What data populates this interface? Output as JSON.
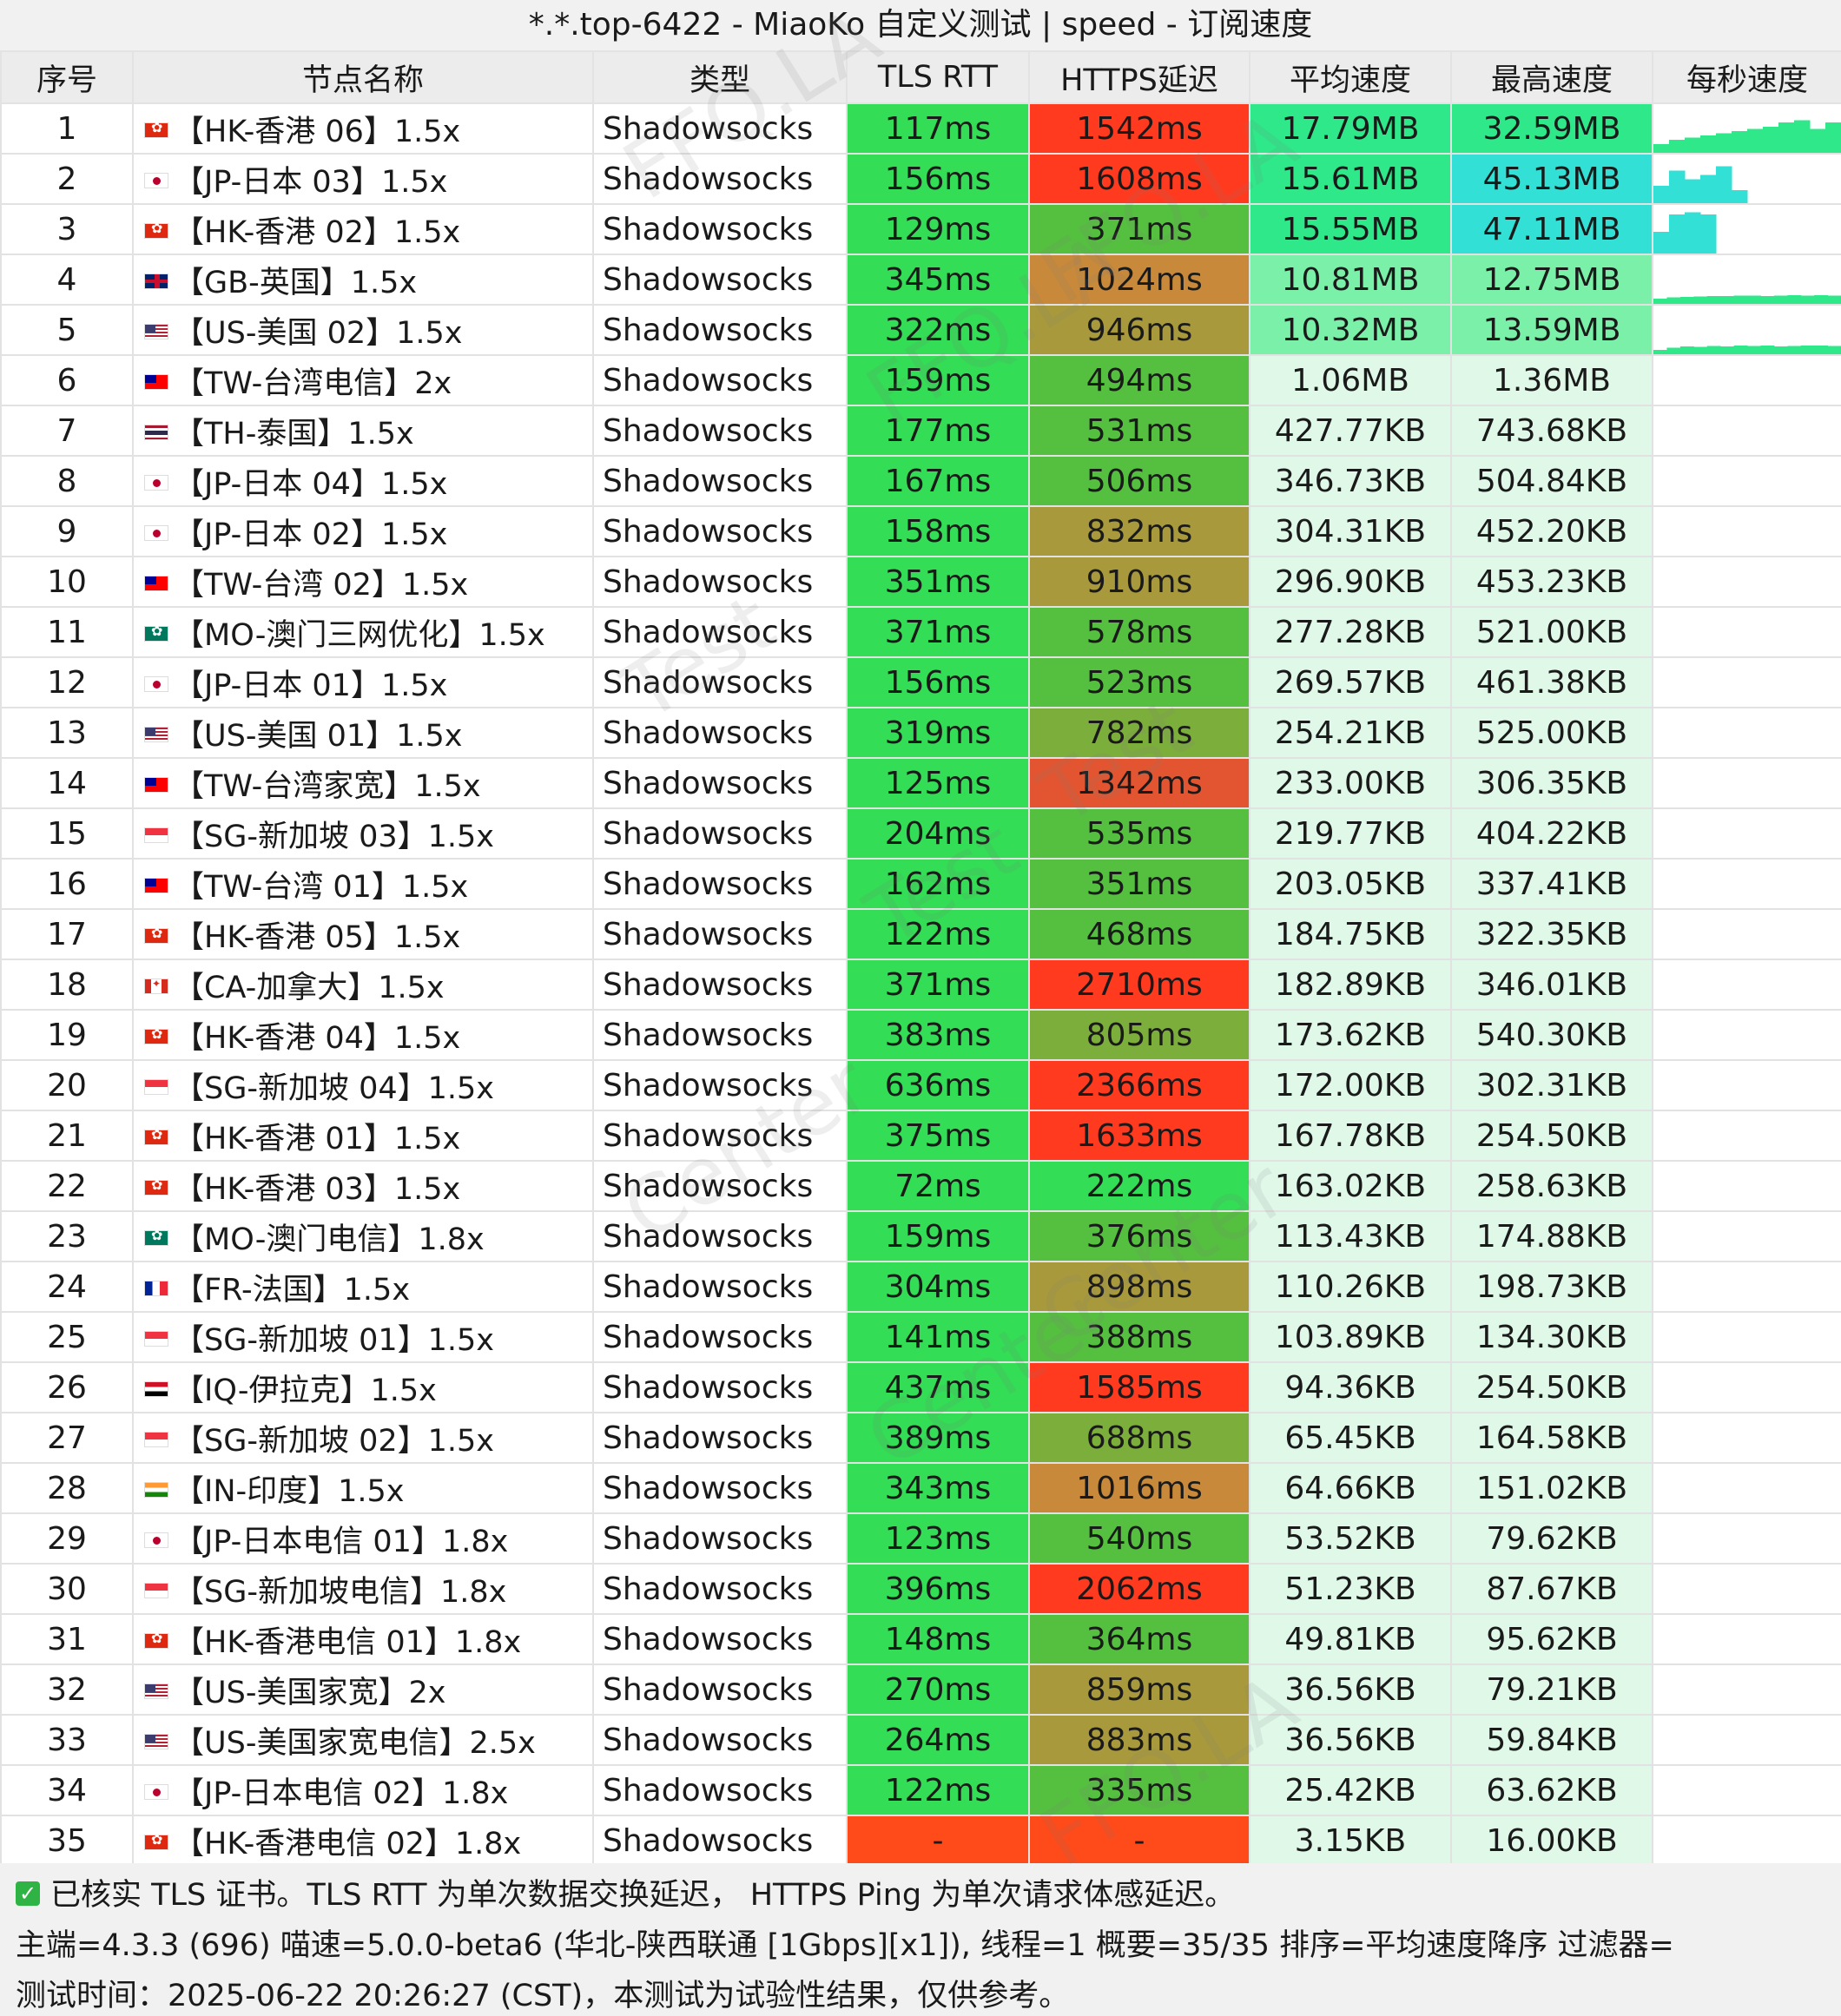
{
  "title": "*.*.top-6422 - MiaoKo 自定义测试 | speed - 订阅速度",
  "columns": {
    "index": "序号",
    "name": "节点名称",
    "type": "类型",
    "tls_rtt": "TLS RTT",
    "https_delay": "HTTPS延迟",
    "avg_speed": "平均速度",
    "max_speed": "最高速度",
    "per_second": "每秒速度"
  },
  "colors": {
    "tls_green": "#33dd55",
    "https_scale": [
      "#33dd55",
      "#55c040",
      "#7cae3c",
      "#a8993c",
      "#c8893a",
      "#e35530",
      "#ff3a1f"
    ],
    "speed_top": "#2ee88a",
    "speed_mid": "#7af0a8",
    "speed_low": "#dff8e8",
    "cyan": "#33e0d5",
    "fail": "#ff4a1a"
  },
  "rows": [
    {
      "idx": "1",
      "flag": "hk",
      "name": "【HK-香港 06】1.5x",
      "type": "Shadowsocks",
      "tls": "117ms",
      "https": "1542ms",
      "https_level": 6,
      "avg": "17.79MB",
      "avg_level": "top",
      "max": "32.59MB",
      "max_level": "top",
      "spark": [
        0.2,
        0.3,
        0.35,
        0.4,
        0.45,
        0.5,
        0.55,
        0.6,
        0.7,
        0.75,
        0.55,
        0.7
      ],
      "spark_color": "#2ee88a"
    },
    {
      "idx": "2",
      "flag": "jp",
      "name": "【JP-日本 03】1.5x",
      "type": "Shadowsocks",
      "tls": "156ms",
      "https": "1608ms",
      "https_level": 6,
      "avg": "15.61MB",
      "avg_level": "top",
      "max": "45.13MB",
      "max_level": "cyan",
      "spark": [
        0.4,
        0.75,
        0.55,
        0.65,
        0.85,
        0.3
      ],
      "spark_color": "#33e0d5"
    },
    {
      "idx": "3",
      "flag": "hk",
      "name": "【HK-香港 02】1.5x",
      "type": "Shadowsocks",
      "tls": "129ms",
      "https": "371ms",
      "https_level": 1,
      "avg": "15.55MB",
      "avg_level": "top",
      "max": "47.11MB",
      "max_level": "cyan",
      "spark": [
        0.5,
        0.9,
        0.95,
        0.9
      ],
      "spark_color": "#33e0d5"
    },
    {
      "idx": "4",
      "flag": "gb",
      "name": "【GB-英国】1.5x",
      "type": "Shadowsocks",
      "tls": "345ms",
      "https": "1024ms",
      "https_level": 4,
      "avg": "10.81MB",
      "avg_level": "mid",
      "max": "12.75MB",
      "max_level": "mid",
      "spark": [
        0.12,
        0.15,
        0.16,
        0.17,
        0.18,
        0.18,
        0.19,
        0.19,
        0.18,
        0.19,
        0.2,
        0.19,
        0.2,
        0.19
      ],
      "spark_color": "#2ee88a"
    },
    {
      "idx": "5",
      "flag": "us",
      "name": "【US-美国 02】1.5x",
      "type": "Shadowsocks",
      "tls": "322ms",
      "https": "946ms",
      "https_level": 3,
      "avg": "10.32MB",
      "avg_level": "mid",
      "max": "13.59MB",
      "max_level": "mid",
      "spark": [
        0.1,
        0.15,
        0.18,
        0.17,
        0.19,
        0.18,
        0.2,
        0.19,
        0.2,
        0.18,
        0.19,
        0.2,
        0.2,
        0.19
      ],
      "spark_color": "#2ee88a"
    },
    {
      "idx": "6",
      "flag": "tw",
      "name": "【TW-台湾电信】2x",
      "type": "Shadowsocks",
      "tls": "159ms",
      "https": "494ms",
      "https_level": 1,
      "avg": "1.06MB",
      "avg_level": "low",
      "max": "1.36MB",
      "max_level": "low",
      "spark": [],
      "spark_color": "#2ee88a"
    },
    {
      "idx": "7",
      "flag": "th",
      "name": "【TH-泰国】1.5x",
      "type": "Shadowsocks",
      "tls": "177ms",
      "https": "531ms",
      "https_level": 1,
      "avg": "427.77KB",
      "avg_level": "low",
      "max": "743.68KB",
      "max_level": "low",
      "spark": [],
      "spark_color": "#2ee88a"
    },
    {
      "idx": "8",
      "flag": "jp",
      "name": "【JP-日本 04】1.5x",
      "type": "Shadowsocks",
      "tls": "167ms",
      "https": "506ms",
      "https_level": 1,
      "avg": "346.73KB",
      "avg_level": "low",
      "max": "504.84KB",
      "max_level": "low",
      "spark": [],
      "spark_color": "#2ee88a"
    },
    {
      "idx": "9",
      "flag": "jp",
      "name": "【JP-日本 02】1.5x",
      "type": "Shadowsocks",
      "tls": "158ms",
      "https": "832ms",
      "https_level": 3,
      "avg": "304.31KB",
      "avg_level": "low",
      "max": "452.20KB",
      "max_level": "low",
      "spark": [],
      "spark_color": "#2ee88a"
    },
    {
      "idx": "10",
      "flag": "tw",
      "name": "【TW-台湾 02】1.5x",
      "type": "Shadowsocks",
      "tls": "351ms",
      "https": "910ms",
      "https_level": 3,
      "avg": "296.90KB",
      "avg_level": "low",
      "max": "453.23KB",
      "max_level": "low",
      "spark": [],
      "spark_color": "#2ee88a"
    },
    {
      "idx": "11",
      "flag": "mo",
      "name": "【MO-澳门三网优化】1.5x",
      "type": "Shadowsocks",
      "tls": "371ms",
      "https": "578ms",
      "https_level": 1,
      "avg": "277.28KB",
      "avg_level": "low",
      "max": "521.00KB",
      "max_level": "low",
      "spark": [],
      "spark_color": "#2ee88a"
    },
    {
      "idx": "12",
      "flag": "jp",
      "name": "【JP-日本 01】1.5x",
      "type": "Shadowsocks",
      "tls": "156ms",
      "https": "523ms",
      "https_level": 1,
      "avg": "269.57KB",
      "avg_level": "low",
      "max": "461.38KB",
      "max_level": "low",
      "spark": [],
      "spark_color": "#2ee88a"
    },
    {
      "idx": "13",
      "flag": "us",
      "name": "【US-美国 01】1.5x",
      "type": "Shadowsocks",
      "tls": "319ms",
      "https": "782ms",
      "https_level": 2,
      "avg": "254.21KB",
      "avg_level": "low",
      "max": "525.00KB",
      "max_level": "low",
      "spark": [],
      "spark_color": "#2ee88a"
    },
    {
      "idx": "14",
      "flag": "tw",
      "name": "【TW-台湾家宽】1.5x",
      "type": "Shadowsocks",
      "tls": "125ms",
      "https": "1342ms",
      "https_level": 5,
      "avg": "233.00KB",
      "avg_level": "low",
      "max": "306.35KB",
      "max_level": "low",
      "spark": [],
      "spark_color": "#2ee88a"
    },
    {
      "idx": "15",
      "flag": "sg",
      "name": "【SG-新加坡 03】1.5x",
      "type": "Shadowsocks",
      "tls": "204ms",
      "https": "535ms",
      "https_level": 1,
      "avg": "219.77KB",
      "avg_level": "low",
      "max": "404.22KB",
      "max_level": "low",
      "spark": [],
      "spark_color": "#2ee88a"
    },
    {
      "idx": "16",
      "flag": "tw",
      "name": "【TW-台湾 01】1.5x",
      "type": "Shadowsocks",
      "tls": "162ms",
      "https": "351ms",
      "https_level": 1,
      "avg": "203.05KB",
      "avg_level": "low",
      "max": "337.41KB",
      "max_level": "low",
      "spark": [],
      "spark_color": "#2ee88a"
    },
    {
      "idx": "17",
      "flag": "hk",
      "name": "【HK-香港 05】1.5x",
      "type": "Shadowsocks",
      "tls": "122ms",
      "https": "468ms",
      "https_level": 1,
      "avg": "184.75KB",
      "avg_level": "low",
      "max": "322.35KB",
      "max_level": "low",
      "spark": [],
      "spark_color": "#2ee88a"
    },
    {
      "idx": "18",
      "flag": "ca",
      "name": "【CA-加拿大】1.5x",
      "type": "Shadowsocks",
      "tls": "371ms",
      "https": "2710ms",
      "https_level": 6,
      "avg": "182.89KB",
      "avg_level": "low",
      "max": "346.01KB",
      "max_level": "low",
      "spark": [],
      "spark_color": "#2ee88a"
    },
    {
      "idx": "19",
      "flag": "hk",
      "name": "【HK-香港 04】1.5x",
      "type": "Shadowsocks",
      "tls": "383ms",
      "https": "805ms",
      "https_level": 2,
      "avg": "173.62KB",
      "avg_level": "low",
      "max": "540.30KB",
      "max_level": "low",
      "spark": [],
      "spark_color": "#2ee88a"
    },
    {
      "idx": "20",
      "flag": "sg",
      "name": "【SG-新加坡 04】1.5x",
      "type": "Shadowsocks",
      "tls": "636ms",
      "https": "2366ms",
      "https_level": 6,
      "avg": "172.00KB",
      "avg_level": "low",
      "max": "302.31KB",
      "max_level": "low",
      "spark": [],
      "spark_color": "#2ee88a"
    },
    {
      "idx": "21",
      "flag": "hk",
      "name": "【HK-香港 01】1.5x",
      "type": "Shadowsocks",
      "tls": "375ms",
      "https": "1633ms",
      "https_level": 6,
      "avg": "167.78KB",
      "avg_level": "low",
      "max": "254.50KB",
      "max_level": "low",
      "spark": [],
      "spark_color": "#2ee88a"
    },
    {
      "idx": "22",
      "flag": "hk",
      "name": "【HK-香港 03】1.5x",
      "type": "Shadowsocks",
      "tls": "72ms",
      "https": "222ms",
      "https_level": 0,
      "avg": "163.02KB",
      "avg_level": "low",
      "max": "258.63KB",
      "max_level": "low",
      "spark": [],
      "spark_color": "#2ee88a"
    },
    {
      "idx": "23",
      "flag": "mo",
      "name": "【MO-澳门电信】1.8x",
      "type": "Shadowsocks",
      "tls": "159ms",
      "https": "376ms",
      "https_level": 1,
      "avg": "113.43KB",
      "avg_level": "low",
      "max": "174.88KB",
      "max_level": "low",
      "spark": [],
      "spark_color": "#2ee88a"
    },
    {
      "idx": "24",
      "flag": "fr",
      "name": "【FR-法国】1.5x",
      "type": "Shadowsocks",
      "tls": "304ms",
      "https": "898ms",
      "https_level": 3,
      "avg": "110.26KB",
      "avg_level": "low",
      "max": "198.73KB",
      "max_level": "low",
      "spark": [],
      "spark_color": "#2ee88a"
    },
    {
      "idx": "25",
      "flag": "sg",
      "name": "【SG-新加坡 01】1.5x",
      "type": "Shadowsocks",
      "tls": "141ms",
      "https": "388ms",
      "https_level": 1,
      "avg": "103.89KB",
      "avg_level": "low",
      "max": "134.30KB",
      "max_level": "low",
      "spark": [],
      "spark_color": "#2ee88a"
    },
    {
      "idx": "26",
      "flag": "iq",
      "name": "【IQ-伊拉克】1.5x",
      "type": "Shadowsocks",
      "tls": "437ms",
      "https": "1585ms",
      "https_level": 6,
      "avg": "94.36KB",
      "avg_level": "low",
      "max": "254.50KB",
      "max_level": "low",
      "spark": [],
      "spark_color": "#2ee88a"
    },
    {
      "idx": "27",
      "flag": "sg",
      "name": "【SG-新加坡 02】1.5x",
      "type": "Shadowsocks",
      "tls": "389ms",
      "https": "688ms",
      "https_level": 2,
      "avg": "65.45KB",
      "avg_level": "low",
      "max": "164.58KB",
      "max_level": "low",
      "spark": [],
      "spark_color": "#2ee88a"
    },
    {
      "idx": "28",
      "flag": "in",
      "name": "【IN-印度】1.5x",
      "type": "Shadowsocks",
      "tls": "343ms",
      "https": "1016ms",
      "https_level": 4,
      "avg": "64.66KB",
      "avg_level": "low",
      "max": "151.02KB",
      "max_level": "low",
      "spark": [],
      "spark_color": "#2ee88a"
    },
    {
      "idx": "29",
      "flag": "jp",
      "name": "【JP-日本电信 01】1.8x",
      "type": "Shadowsocks",
      "tls": "123ms",
      "https": "540ms",
      "https_level": 1,
      "avg": "53.52KB",
      "avg_level": "low",
      "max": "79.62KB",
      "max_level": "low",
      "spark": [],
      "spark_color": "#2ee88a"
    },
    {
      "idx": "30",
      "flag": "sg",
      "name": "【SG-新加坡电信】1.8x",
      "type": "Shadowsocks",
      "tls": "396ms",
      "https": "2062ms",
      "https_level": 6,
      "avg": "51.23KB",
      "avg_level": "low",
      "max": "87.67KB",
      "max_level": "low",
      "spark": [],
      "spark_color": "#2ee88a"
    },
    {
      "idx": "31",
      "flag": "hk",
      "name": "【HK-香港电信 01】1.8x",
      "type": "Shadowsocks",
      "tls": "148ms",
      "https": "364ms",
      "https_level": 1,
      "avg": "49.81KB",
      "avg_level": "low",
      "max": "95.62KB",
      "max_level": "low",
      "spark": [],
      "spark_color": "#2ee88a"
    },
    {
      "idx": "32",
      "flag": "us",
      "name": "【US-美国家宽】2x",
      "type": "Shadowsocks",
      "tls": "270ms",
      "https": "859ms",
      "https_level": 3,
      "avg": "36.56KB",
      "avg_level": "low",
      "max": "79.21KB",
      "max_level": "low",
      "spark": [],
      "spark_color": "#2ee88a"
    },
    {
      "idx": "33",
      "flag": "us",
      "name": "【US-美国家宽电信】2.5x",
      "type": "Shadowsocks",
      "tls": "264ms",
      "https": "883ms",
      "https_level": 3,
      "avg": "36.56KB",
      "avg_level": "low",
      "max": "59.84KB",
      "max_level": "low",
      "spark": [],
      "spark_color": "#2ee88a"
    },
    {
      "idx": "34",
      "flag": "jp",
      "name": "【JP-日本电信 02】1.8x",
      "type": "Shadowsocks",
      "tls": "122ms",
      "https": "335ms",
      "https_level": 1,
      "avg": "25.42KB",
      "avg_level": "low",
      "max": "63.62KB",
      "max_level": "low",
      "spark": [],
      "spark_color": "#2ee88a"
    },
    {
      "idx": "35",
      "flag": "hk",
      "name": "【HK-香港电信 02】1.8x",
      "type": "Shadowsocks",
      "tls": "-",
      "https": "-",
      "https_level": "fail",
      "tls_fail": true,
      "avg": "3.15KB",
      "avg_level": "low",
      "max": "16.00KB",
      "max_level": "low",
      "spark": [],
      "spark_color": "#2ee88a"
    }
  ],
  "footer": {
    "line1": "已核实 TLS 证书。TLS RTT 为单次数据交换延迟， HTTPS Ping 为单次请求体感延迟。",
    "line2": "主端=4.3.3 (696) 喵速=5.0.0-beta6 (󠁿华北-陕西联通 [1Gbps][x1]), 线程=1 概要=35/35 排序=平均速度降序 过滤器=",
    "line3": "测试时间：2025-06-22 20:26:27 (CST)，本测试为试验性结果，仅供参考。"
  },
  "watermark": [
    "FFQ.LA",
    "Test",
    "Center"
  ]
}
